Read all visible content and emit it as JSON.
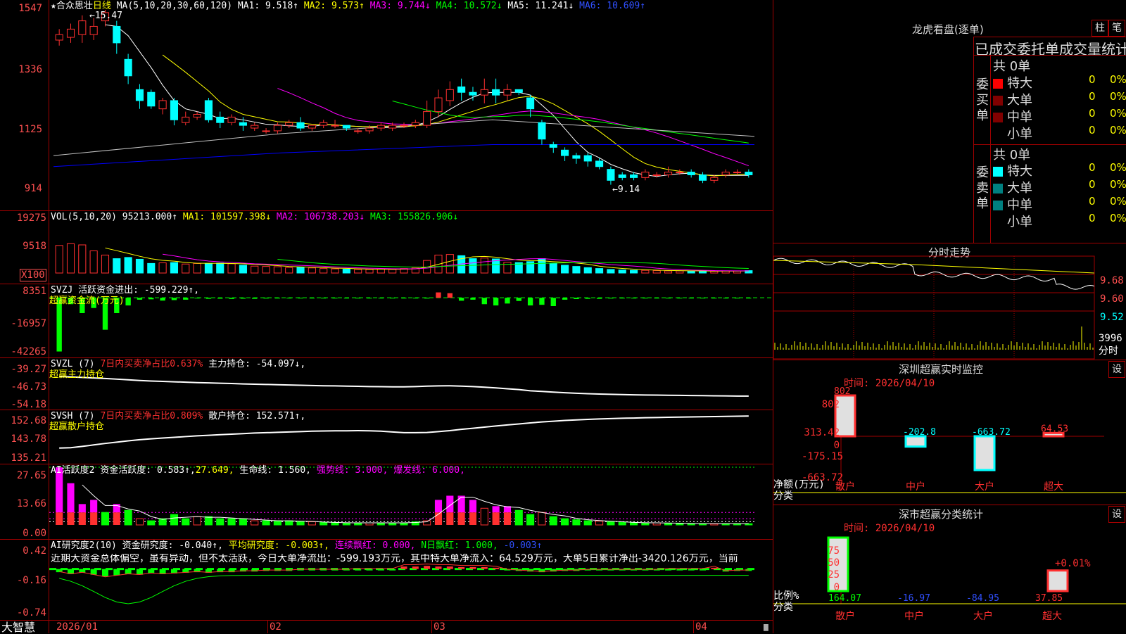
{
  "colors": {
    "up": "#ff3030",
    "down": "#00ffff",
    "bg": "#000000",
    "grid": "#a00000",
    "ma1": "#ffffff",
    "ma2": "#ffff00",
    "ma3": "#ff00ff",
    "ma4": "#00ff00",
    "ma5": "#c0c0c0",
    "ma6": "#0000ff",
    "green": "#00ff00",
    "magenta": "#ff00ff"
  },
  "main": {
    "y_labels": [
      "1547",
      "1336",
      "1125",
      "914"
    ],
    "title_star": "★",
    "stock_name": "合众思壮",
    "period": "日线",
    "ma_header": "MA(5,10,20,30,60,120)",
    "ma1": "MA1: 9.518↑",
    "ma2": "MA2: 9.573↑",
    "ma3": "MA3: 9.744↓",
    "ma4": "MA4: 10.572↓",
    "ma5": "MA5: 11.241↓",
    "ma6": "MA6: 10.609↑",
    "high_mark": "15.47",
    "low_mark": "9.14"
  },
  "vol": {
    "y_labels": [
      "19275",
      "9518",
      "X100"
    ],
    "header": "VOL(5,10,20)",
    "value": "95213.000↑",
    "ma1": "MA1: 101597.398↓",
    "ma2": "MA2: 106738.203↓",
    "ma3": "MA3: 155826.906↓"
  },
  "svzj": {
    "y_labels": [
      "8351",
      "-16957",
      "-42265"
    ],
    "header": "SVZJ",
    "active": "活跃资金进出: -599.229↑,",
    "title2": "超赢资金流(万元)"
  },
  "svzl": {
    "y_labels": [
      "-39.27",
      "-46.73",
      "-54.18"
    ],
    "header": "SVZL (7)",
    "ratio": "7日内买卖净占比0.637%",
    "hold": "主力持仓: -54.097↓,",
    "title2": "超赢主力持仓"
  },
  "svsh": {
    "y_labels": [
      "152.68",
      "143.78",
      "135.21"
    ],
    "header": "SVSH (7)",
    "ratio": "7日内买卖净占比0.809%",
    "hold": "散户持仓: 152.571↑,",
    "title2": "超赢散户持仓"
  },
  "ai1": {
    "y_labels": [
      "27.65",
      "13.66",
      "0.00"
    ],
    "header": "AI活跃度2",
    "active": "资金活跃度: 0.583↑,",
    "v2": "27.649,",
    "life": "生命线: 1.560,",
    "strong": "强势线: 3.000,",
    "burst": "爆发线: 6.000,"
  },
  "ai2": {
    "y_labels": [
      "0.42",
      "-0.16",
      "-0.74"
    ],
    "header": "AI研究度2(10)",
    "research": "资金研究度: -0.040↑,",
    "avg": "平均研究度: -0.003↑,",
    "cont": "连续飘红: 0.000,",
    "nday": "N日飘红: 1.000,",
    "last": "-0.003↑",
    "note": "近期大资金总体偏空，虽有异动，但不太活跃，今日大单净流出：-599.193万元，其中特大单净流入：64.529万元，大单5日累计净出-3420.126万元，当前"
  },
  "xaxis": {
    "labels": [
      "2026/01",
      "02",
      "03",
      "04"
    ],
    "brand": "大智慧"
  },
  "right": {
    "lhb_title": "龙虎看盘(逐单)",
    "btn_zhu": "柱",
    "btn_bi": "笔",
    "section_title": "已成交委托单成交量统计",
    "buy_label": "委买单",
    "sell_label": "委卖单",
    "buy_total": "共 0单",
    "sell_total": "共 0单",
    "buy_rows": [
      {
        "name": "特大",
        "n": "0",
        "p": "0%",
        "c": "#ff0000"
      },
      {
        "name": "大单",
        "n": "0",
        "p": "0%",
        "c": "#800000"
      },
      {
        "name": "中单",
        "n": "0",
        "p": "0%",
        "c": "#800000"
      },
      {
        "name": "小单",
        "n": "0",
        "p": "0%",
        "c": "#000000"
      }
    ],
    "sell_rows": [
      {
        "name": "特大",
        "n": "0",
        "p": "0%",
        "c": "#00ffff"
      },
      {
        "name": "大单",
        "n": "0",
        "p": "0%",
        "c": "#008080"
      },
      {
        "name": "中单",
        "n": "0",
        "p": "0%",
        "c": "#008080"
      },
      {
        "name": "小单",
        "n": "0",
        "p": "0%",
        "c": "#000000"
      }
    ],
    "fs_title": "分时走势",
    "fs_labels": [
      "9.68",
      "9.60",
      "9.52"
    ],
    "fs_vol": "3996",
    "fs_unit": "分时",
    "sz_title": "深圳超赢实时监控",
    "sz_btn": "设",
    "sz_time": "时间: 2026/04/10",
    "sz_y": [
      "802",
      "313.42",
      "0",
      "-175.15",
      "-663.72"
    ],
    "sz_unit1": "净额(万元)",
    "sz_unit2": "分类",
    "sz_values": [
      "802",
      "-202.8",
      "-663.72",
      "64.53"
    ],
    "sz_cats": [
      "散户",
      "中户",
      "大户",
      "超大"
    ],
    "cls_title": "深市超赢分类统计",
    "cls_btn": "设",
    "cls_time": "时间: 2026/04/10",
    "cls_y": [
      "75",
      "50",
      "25",
      "0"
    ],
    "cls_unit1": "比例%",
    "cls_unit2": "分类",
    "cls_values": [
      "164.07",
      "-16.97",
      "-84.95",
      "37.85"
    ],
    "cls_pct": "+0.01%",
    "cls_cats": [
      "散户",
      "中户",
      "大户",
      "超大"
    ]
  },
  "chart_data": [
    {
      "type": "candlestick",
      "x_labels": [
        "2026/01",
        "02",
        "03",
        "04"
      ],
      "ylim": [
        9.0,
        15.5
      ],
      "tick_labels": [
        "1547",
        "1336",
        "1125",
        "914"
      ],
      "candles": [
        [
          14.4,
          14.6,
          14.2,
          14.8
        ],
        [
          14.5,
          14.8,
          14.3,
          15.0
        ],
        [
          14.6,
          15.1,
          14.3,
          15.3
        ],
        [
          14.6,
          14.9,
          14.4,
          15.2
        ],
        [
          15.1,
          15.4,
          14.9,
          15.5
        ],
        [
          14.9,
          14.3,
          13.9,
          15.1
        ],
        [
          13.7,
          13.1,
          12.8,
          13.9
        ],
        [
          12.6,
          12.2,
          11.9,
          12.8
        ],
        [
          12.5,
          12.0,
          11.9,
          12.6
        ],
        [
          11.9,
          12.2,
          11.7,
          12.3
        ],
        [
          12.2,
          11.5,
          11.3,
          12.3
        ],
        [
          11.4,
          11.6,
          11.3,
          11.8
        ],
        [
          11.6,
          11.7,
          11.5,
          11.8
        ],
        [
          12.2,
          11.5,
          11.4,
          12.3
        ],
        [
          11.6,
          11.4,
          11.2,
          11.8
        ],
        [
          11.4,
          11.6,
          11.3,
          11.7
        ],
        [
          11.4,
          11.3,
          11.1,
          11.6
        ],
        [
          11.2,
          11.3,
          11.1,
          11.4
        ],
        [
          11.1,
          11.1,
          11.0,
          11.2
        ],
        [
          11.1,
          11.3,
          11.0,
          11.4
        ],
        [
          11.3,
          11.4,
          11.2,
          11.5
        ],
        [
          11.4,
          11.2,
          11.1,
          11.6
        ],
        [
          11.2,
          11.3,
          11.1,
          11.3
        ],
        [
          11.3,
          11.4,
          11.2,
          11.5
        ],
        [
          11.3,
          11.3,
          11.2,
          11.5
        ],
        [
          11.3,
          11.2,
          11.1,
          11.3
        ],
        [
          11.1,
          11.1,
          11.0,
          11.2
        ],
        [
          11.1,
          11.2,
          11.0,
          11.3
        ],
        [
          11.2,
          11.3,
          11.1,
          11.4
        ],
        [
          11.2,
          11.3,
          11.1,
          11.4
        ],
        [
          11.3,
          11.3,
          11.2,
          11.4
        ],
        [
          11.3,
          11.4,
          11.2,
          11.5
        ],
        [
          11.3,
          11.8,
          11.2,
          12.2
        ],
        [
          11.8,
          12.3,
          11.6,
          12.6
        ],
        [
          12.2,
          12.6,
          12.0,
          12.9
        ],
        [
          12.7,
          12.5,
          12.2,
          13.0
        ],
        [
          12.5,
          12.4,
          12.2,
          12.7
        ],
        [
          12.4,
          12.6,
          12.1,
          13.0
        ],
        [
          12.6,
          12.4,
          12.1,
          13.0
        ],
        [
          12.4,
          12.6,
          12.2,
          12.8
        ],
        [
          12.6,
          12.5,
          12.4,
          12.6
        ],
        [
          12.3,
          11.9,
          11.6,
          12.4
        ],
        [
          11.4,
          10.8,
          10.6,
          11.5
        ],
        [
          10.6,
          10.5,
          10.3,
          10.7
        ],
        [
          10.4,
          10.2,
          10.0,
          10.5
        ],
        [
          10.2,
          10.1,
          9.9,
          10.3
        ],
        [
          10.2,
          10.0,
          9.8,
          10.3
        ],
        [
          10.0,
          9.8,
          9.7,
          10.1
        ],
        [
          9.7,
          9.3,
          9.14,
          9.8
        ],
        [
          9.5,
          9.4,
          9.3,
          9.6
        ],
        [
          9.5,
          9.4,
          9.3,
          9.6
        ],
        [
          9.4,
          9.6,
          9.3,
          9.7
        ],
        [
          9.5,
          9.5,
          9.4,
          9.6
        ],
        [
          9.5,
          9.6,
          9.4,
          9.8
        ],
        [
          9.6,
          9.6,
          9.5,
          9.7
        ],
        [
          9.6,
          9.5,
          9.4,
          9.7
        ],
        [
          9.5,
          9.3,
          9.2,
          9.6
        ],
        [
          9.3,
          9.4,
          9.2,
          9.5
        ],
        [
          9.5,
          9.6,
          9.4,
          9.7
        ],
        [
          9.6,
          9.6,
          9.5,
          9.7
        ],
        [
          9.6,
          9.5,
          9.4,
          9.7
        ]
      ]
    },
    {
      "type": "bar",
      "name": "VOL",
      "ylim": [
        0,
        19275
      ],
      "values": [
        9200,
        9800,
        9400,
        7400,
        6000,
        4800,
        5200,
        4600,
        3200,
        3400,
        3500,
        3000,
        3200,
        3200,
        3300,
        3100,
        2600,
        2300,
        2200,
        2100,
        1800,
        1900,
        1700,
        1500,
        1400,
        1300,
        1200,
        1200,
        1300,
        1200,
        1500,
        1700,
        4200,
        6000,
        6200,
        5800,
        4800,
        5000,
        4700,
        3600,
        3500,
        3800,
        4800,
        3300,
        2600,
        2200,
        1800,
        1500,
        1200,
        1000,
        900,
        900,
        800,
        700,
        700,
        600,
        700,
        600,
        700,
        700,
        800
      ]
    },
    {
      "type": "bar",
      "name": "超赢资金流",
      "ylim": [
        -42265,
        8351
      ],
      "values": [
        -42000,
        -5000,
        -12000,
        -8000,
        -25000,
        -12000,
        -6000,
        -1500,
        -1200,
        -2200,
        -1800,
        -1500,
        -500,
        -800,
        -700,
        -900,
        -700,
        -800,
        -600,
        -500,
        -400,
        -300,
        -400,
        -300,
        -300,
        -200,
        -300,
        -200,
        -200,
        -200,
        -300,
        -400,
        -600,
        4200,
        3600,
        -2300,
        -1500,
        -5000,
        -6000,
        -4500,
        -2500,
        -6000,
        -5500,
        -6500,
        -1500,
        -1000,
        -800,
        -800,
        -600,
        -500,
        -500,
        -500,
        -400,
        -400,
        -300,
        -300,
        -300,
        -300,
        -300,
        -300,
        -300
      ]
    },
    {
      "type": "line",
      "name": "超赢主力持仓",
      "ylim": [
        -54.18,
        -39.27
      ],
      "values": [
        -39.3,
        -39.6,
        -40.0,
        -40.4,
        -40.8,
        -41.3,
        -41.8,
        -42.3,
        -42.7,
        -43.0,
        -43.3,
        -43.6,
        -43.9,
        -44.1,
        -44.4,
        -44.6,
        -44.9,
        -45.1,
        -45.3,
        -45.5,
        -45.7,
        -45.9,
        -46.1,
        -46.3,
        -46.4,
        -46.6,
        -46.7,
        -46.9,
        -47.0,
        -47.1,
        -47.1,
        -46.9,
        -46.6,
        -46.4,
        -46.3,
        -46.6,
        -46.9,
        -47.4,
        -47.9,
        -48.6,
        -49.2,
        -50.1,
        -50.6,
        -51.1,
        -51.6,
        -52.0,
        -52.3,
        -52.6,
        -52.8,
        -53.0,
        -53.2,
        -53.3,
        -53.4,
        -53.5,
        -53.6,
        -53.7,
        -53.8,
        -53.9,
        -54.0,
        -54.1,
        -54.1
      ]
    },
    {
      "type": "line",
      "name": "超赢散户持仓",
      "ylim": [
        135.21,
        152.68
      ],
      "values": [
        135.3,
        135.5,
        136.2,
        137.0,
        137.8,
        138.5,
        139.2,
        139.8,
        140.3,
        140.7,
        141.1,
        141.5,
        141.9,
        142.2,
        142.5,
        142.8,
        143.1,
        143.4,
        143.6,
        143.8,
        144.0,
        144.2,
        144.4,
        144.5,
        144.6,
        144.6,
        144.7,
        144.6,
        144.4,
        144.0,
        143.6,
        143.6,
        143.7,
        144.2,
        144.7,
        145.4,
        146.0,
        146.6,
        147.2,
        147.8,
        148.3,
        148.9,
        149.4,
        149.8,
        150.2,
        150.5,
        150.8,
        151.0,
        151.2,
        151.4,
        151.5,
        151.7,
        151.8,
        151.9,
        152.0,
        152.1,
        152.2,
        152.3,
        152.4,
        152.5,
        152.6
      ]
    },
    {
      "type": "bar",
      "name": "资金活跃度",
      "ylim": [
        0,
        27.65
      ],
      "values": [
        27.6,
        20,
        10,
        12,
        6,
        10,
        7,
        3,
        2,
        3,
        5,
        3,
        4,
        4,
        3,
        3,
        3,
        2,
        2,
        2,
        2,
        1.5,
        1.5,
        1.2,
        1,
        1,
        1,
        1,
        1,
        1,
        1,
        1.5,
        2,
        12,
        14,
        14,
        12,
        8,
        9,
        9,
        7,
        5,
        6,
        4,
        3,
        2.5,
        2,
        1.8,
        1.5,
        1.2,
        1,
        1,
        1,
        0.8,
        0.7,
        0.6,
        0.6,
        0.6,
        0.6,
        0.6,
        0.6
      ]
    },
    {
      "type": "bar",
      "name": "资金研究度",
      "ylim": [
        -0.74,
        0.42
      ],
      "values": [
        -0.05,
        -0.08,
        -0.06,
        -0.09,
        -0.12,
        -0.1,
        -0.08,
        -0.09,
        -0.07,
        -0.08,
        -0.07,
        -0.06,
        -0.05,
        -0.06,
        -0.05,
        -0.05,
        -0.04,
        -0.04,
        -0.03,
        -0.03,
        -0.03,
        -0.02,
        -0.02,
        -0.02,
        -0.02,
        -0.02,
        -0.01,
        -0.01,
        -0.01,
        -0.01,
        0.04,
        0.04,
        0.05,
        0.04,
        0.04,
        0.03,
        0.03,
        0.03,
        0.02,
        -0.02,
        -0.03,
        -0.04,
        -0.05,
        -0.04,
        -0.03,
        -0.03,
        -0.02,
        -0.02,
        -0.02,
        -0.02,
        -0.02,
        -0.02,
        -0.02,
        -0.01,
        -0.01,
        -0.01,
        -0.01,
        0.02,
        -0.04,
        -0.03,
        -0.03
      ]
    },
    {
      "type": "bar",
      "name": "深圳超赢实时监控",
      "categories": [
        "散户",
        "中户",
        "大户",
        "超大"
      ],
      "values": [
        802,
        -202.8,
        -663.72,
        64.53
      ],
      "ylim": [
        -663.72,
        802
      ]
    },
    {
      "type": "bar",
      "name": "深市超赢分类统计",
      "categories": [
        "散户",
        "中户",
        "大户",
        "超大"
      ],
      "values": [
        164.07,
        -16.97,
        -84.95,
        37.85
      ],
      "ylim": [
        0,
        75
      ]
    }
  ]
}
